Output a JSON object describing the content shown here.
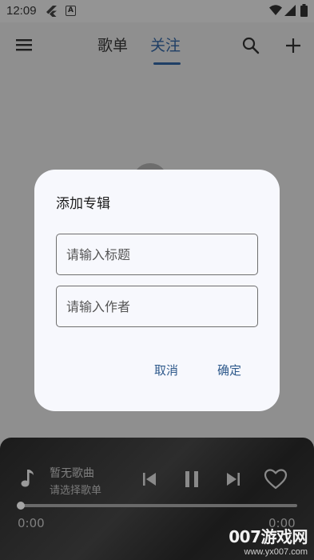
{
  "status_bar": {
    "time": "12:09",
    "icons": [
      "flutter-icon",
      "a-icon",
      "wifi-icon",
      "signal-icon",
      "battery-icon"
    ]
  },
  "app_bar": {
    "tabs": [
      {
        "label": "歌单",
        "selected": false
      },
      {
        "label": "关注",
        "selected": true
      }
    ],
    "icons": [
      "menu-icon",
      "search-icon",
      "add-icon"
    ],
    "accent_color": "#1f3f66"
  },
  "dialog": {
    "title": "添加专辑",
    "fields": [
      {
        "placeholder": "请输入标题",
        "value": ""
      },
      {
        "placeholder": "请输入作者",
        "value": ""
      }
    ],
    "cancel_label": "取消",
    "confirm_label": "确定",
    "button_color": "#2f5a8c"
  },
  "player": {
    "title": "暂无歌曲",
    "subtitle": "请选择歌单",
    "current_time": "0:00",
    "total_time": "0:00",
    "progress": 0,
    "icons": [
      "music-note-icon",
      "skip-previous-icon",
      "pause-icon",
      "skip-next-icon",
      "heart-icon"
    ]
  },
  "watermark": {
    "main": "007游戏网",
    "url": "www.yx007.com"
  }
}
